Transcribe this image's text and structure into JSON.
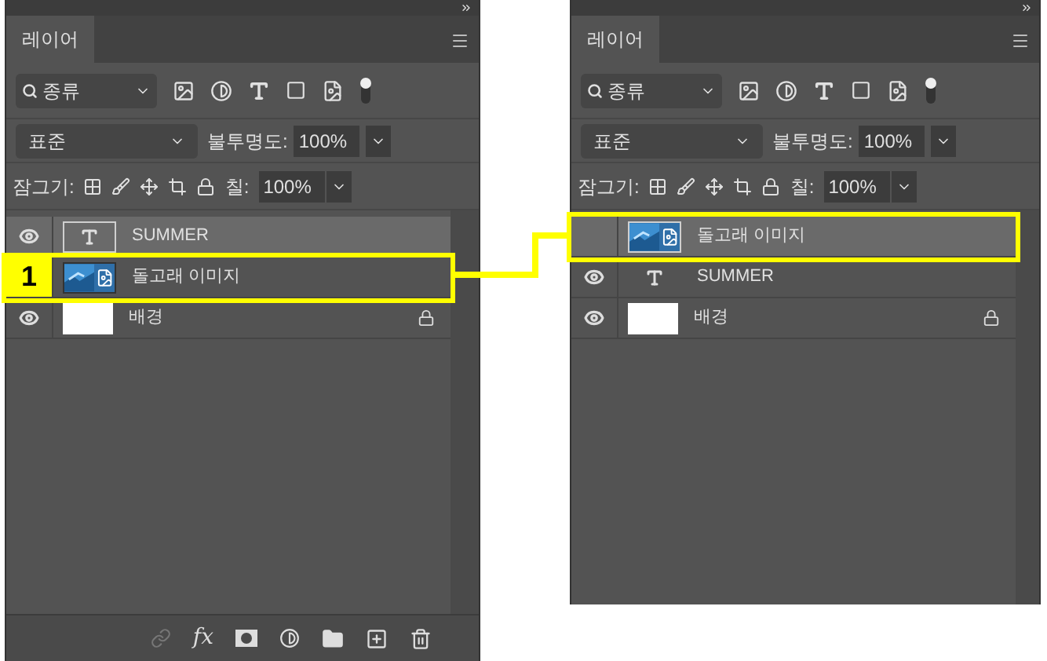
{
  "panels": [
    {
      "tab": "레이어",
      "filter": "종류",
      "blend_mode": "표준",
      "opacity_label": "불투명도:",
      "opacity": "100%",
      "lock_label": "잠그기:",
      "fill_label": "칠:",
      "fill": "100%",
      "show_footer": true,
      "layers": [
        {
          "kind": "text",
          "name": "SUMMER",
          "visible": true,
          "selected": true,
          "locked": false,
          "highlighted": false
        },
        {
          "kind": "image",
          "name": "돌고래 이미지",
          "selected": false,
          "locked": false,
          "highlighted": true,
          "badge": "1"
        },
        {
          "kind": "fill",
          "name": "배경",
          "visible": true,
          "selected": false,
          "locked": true,
          "highlighted": false
        }
      ],
      "footer_fx": "fx"
    },
    {
      "tab": "레이어",
      "filter": "종류",
      "blend_mode": "표준",
      "opacity_label": "불투명도:",
      "opacity": "100%",
      "lock_label": "잠그기:",
      "fill_label": "칠:",
      "fill": "100%",
      "show_footer": false,
      "layers": [
        {
          "kind": "image",
          "name": "돌고래 이미지",
          "visible": false,
          "selected": true,
          "locked": false,
          "highlighted": true
        },
        {
          "kind": "text",
          "name": "SUMMER",
          "visible": true,
          "selected": false,
          "locked": false,
          "highlighted": false
        },
        {
          "kind": "fill",
          "name": "배경",
          "visible": true,
          "selected": false,
          "locked": true,
          "highlighted": false
        }
      ]
    }
  ]
}
